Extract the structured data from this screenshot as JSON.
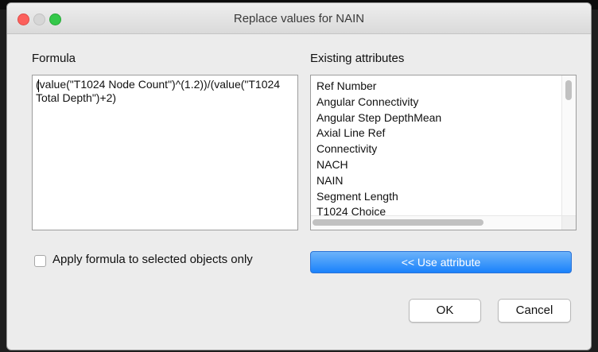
{
  "window": {
    "title": "Replace values for NAIN"
  },
  "formula": {
    "label": "Formula",
    "value": "(value(\"T1024 Node Count\")^(1.2))/(value(\"T1024 Total Depth\")+2)"
  },
  "attributes": {
    "label": "Existing attributes",
    "items": [
      "Ref Number",
      "Angular Connectivity",
      "Angular Step DepthMean",
      "Axial Line Ref",
      "Connectivity",
      "NACH",
      "NAIN",
      "Segment Length",
      "T1024 Choice"
    ]
  },
  "apply_selected": {
    "label": "Apply formula to selected objects only",
    "checked": false
  },
  "buttons": {
    "use_attribute": "<< Use attribute",
    "ok": "OK",
    "cancel": "Cancel"
  },
  "colors": {
    "accent_button": "#1a82fb",
    "close": "#fc605c",
    "zoom": "#34c84a"
  }
}
